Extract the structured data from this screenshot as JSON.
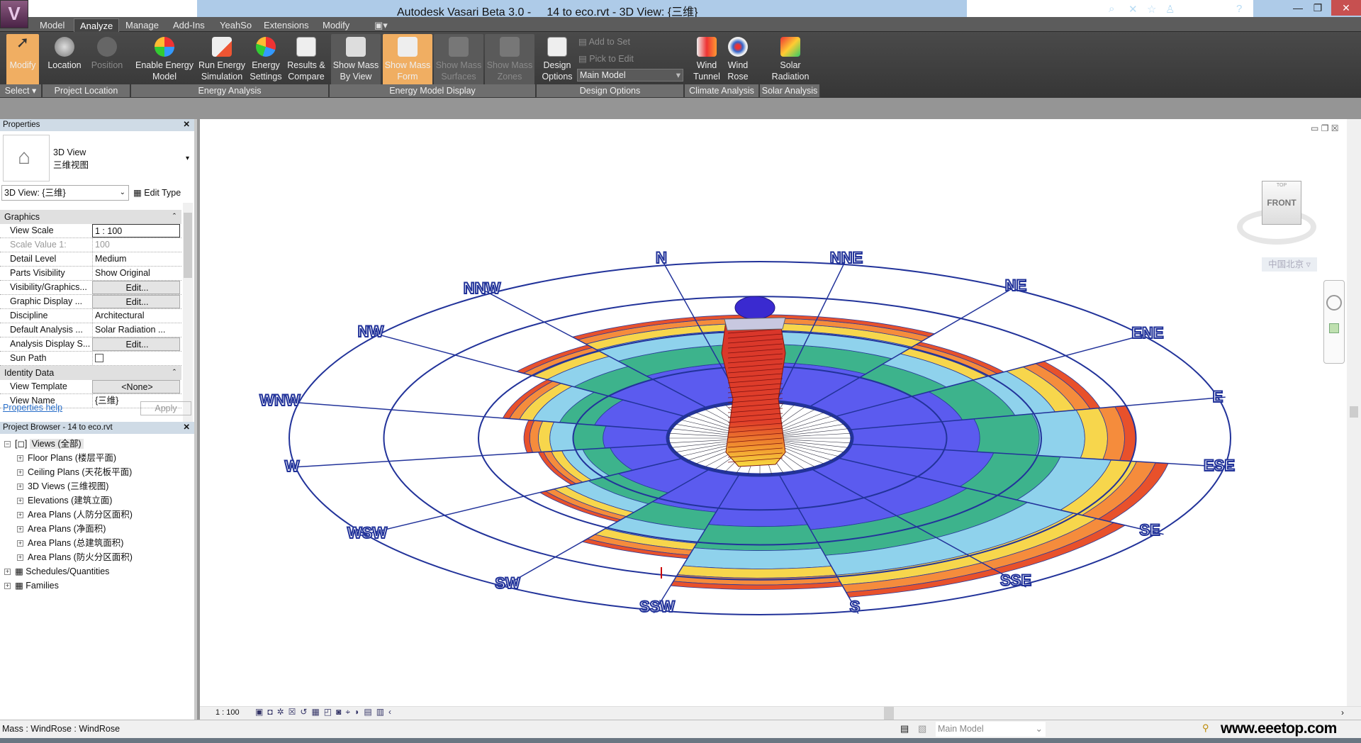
{
  "window": {
    "title": "Autodesk Vasari Beta 3.0 -     14 to eco.rvt - 3D View: {三维}",
    "app_letter": "V"
  },
  "tabs": [
    "Model",
    "Analyze",
    "Manage",
    "Add-Ins",
    "YeahSo",
    "Extensions",
    "Modify"
  ],
  "active_tab": "Analyze",
  "ribbon": {
    "buttons": [
      {
        "label": "Modify",
        "state": "selected"
      },
      {
        "label": "Location",
        "state": "normal"
      },
      {
        "label": "Position",
        "state": "disabled"
      },
      {
        "label": "Enable Energy Model",
        "state": "normal"
      },
      {
        "label": "Run Energy Simulation",
        "state": "normal"
      },
      {
        "label": "Energy Settings",
        "state": "normal"
      },
      {
        "label": "Results & Compare",
        "state": "normal"
      },
      {
        "label": "Show Mass By View",
        "state": "pressed"
      },
      {
        "label": "Show Mass Form",
        "state": "selected"
      },
      {
        "label": "Show Mass Surfaces",
        "state": "disabled"
      },
      {
        "label": "Show Mass Zones",
        "state": "disabled"
      },
      {
        "label": "Design Options",
        "state": "normal"
      },
      {
        "label": "Wind Tunnel",
        "state": "normal"
      },
      {
        "label": "Wind Rose",
        "state": "normal"
      },
      {
        "label": "Solar Radiation",
        "state": "normal"
      }
    ],
    "add_to_set": "Add to Set",
    "pick_to_edit": "Pick to Edit",
    "design_option_select": "Main Model",
    "panels": [
      "Select",
      "Project Location",
      "Energy Analysis",
      "Energy Model Display",
      "Design Options",
      "Climate Analysis",
      "Solar Analysis"
    ]
  },
  "properties": {
    "title": "Properties",
    "type_name": "3D View",
    "type_sub": "三维视图",
    "selector": "3D View: {三维}",
    "edit_type": "Edit Type",
    "groups": [
      {
        "name": "Graphics",
        "rows": [
          {
            "key": "View Scale",
            "value": "1 : 100"
          },
          {
            "key": "Scale Value    1:",
            "value": "100"
          },
          {
            "key": "Detail Level",
            "value": "Medium"
          },
          {
            "key": "Parts Visibility",
            "value": "Show Original"
          },
          {
            "key": "Visibility/Graphics...",
            "value": "Edit..."
          },
          {
            "key": "Graphic Display ...",
            "value": "Edit..."
          },
          {
            "key": "Discipline",
            "value": "Architectural"
          },
          {
            "key": "Default Analysis ...",
            "value": "Solar Radiation ..."
          },
          {
            "key": "Analysis Display S...",
            "value": "Edit..."
          },
          {
            "key": "Sun Path",
            "value": ""
          }
        ]
      },
      {
        "name": "Identity Data",
        "rows": [
          {
            "key": "View Template",
            "value": "<None>"
          },
          {
            "key": "View Name",
            "value": "{三维}"
          }
        ]
      }
    ],
    "help_link": "Properties help",
    "apply": "Apply"
  },
  "project_browser": {
    "title": "Project Browser - 14 to eco.rvt",
    "root": "Views (全部)",
    "children": [
      "Floor Plans (楼层平面)",
      "Ceiling Plans (天花板平面)",
      "3D Views (三维视图)",
      "Elevations (建筑立面)",
      "Area Plans (人防分区面积)",
      "Area Plans (净面积)",
      "Area Plans (总建筑面积)",
      "Area Plans (防火分区面积)"
    ],
    "others": [
      "Schedules/Quantities",
      "Families"
    ]
  },
  "viewcube": {
    "face": "FRONT",
    "top": "TOP",
    "location": "中国北京"
  },
  "wind_rose": {
    "directions": [
      "N",
      "NNE",
      "NE",
      "ENE",
      "E",
      "ESE",
      "SE",
      "SSE",
      "S",
      "SSW",
      "SW",
      "WSW",
      "W",
      "WNW",
      "NW",
      "NNW"
    ],
    "relative_frequency": [
      0.62,
      0.62,
      0.55,
      0.68,
      0.75,
      0.85,
      0.9,
      0.9,
      0.82,
      0.62,
      0.45,
      0.35,
      0.38,
      0.45,
      0.55,
      0.62
    ],
    "band_colors": [
      "#5b5bef",
      "#3db38c",
      "#8fd2ec",
      "#f7d64c",
      "#f58c3c",
      "#e8512b"
    ],
    "ring_color": "#22339a"
  },
  "view_bar": {
    "scale": "1 : 100"
  },
  "status": {
    "text": "Mass : WindRose : WindRose",
    "design_option": "Main Model",
    "watermark": "www.eeetop.com"
  }
}
